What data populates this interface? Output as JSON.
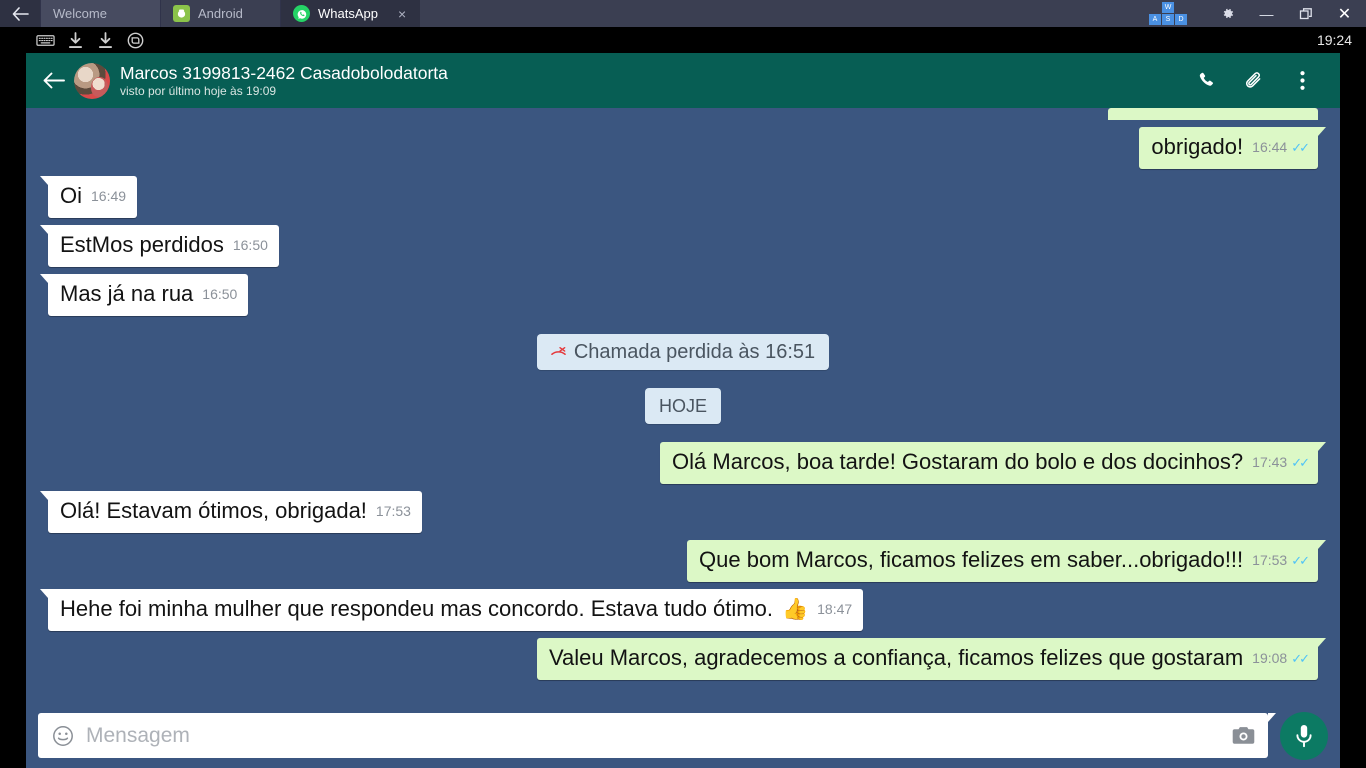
{
  "emulator": {
    "back_icon": "back-arrow-icon",
    "tabs": [
      {
        "label": "Welcome",
        "icon": "none",
        "active": false,
        "closable": false
      },
      {
        "label": "Android",
        "icon": "android-icon",
        "active": false,
        "closable": false
      },
      {
        "label": "WhatsApp",
        "icon": "whatsapp-icon",
        "active": true,
        "closable": true
      }
    ],
    "close_label": "×",
    "keymap_keys": [
      "W",
      "A",
      "S",
      "D"
    ],
    "window_controls": {
      "settings": "gear-icon",
      "minimize": "—",
      "maximize": "maximize-icon",
      "close": "✕"
    },
    "toolbar_icons": [
      "keyboard-icon",
      "download-icon",
      "download-icon",
      "screenshot-icon"
    ],
    "clock": "19:24"
  },
  "whatsapp": {
    "header": {
      "back": "←",
      "contact_name": "Marcos 3199813-2462 Casadobolodatorta",
      "last_seen": "visto por último hoje às 19:09",
      "actions": [
        "call-icon",
        "attach-icon",
        "overflow-menu-icon"
      ]
    },
    "messages": [
      {
        "kind": "partial",
        "side": "out"
      },
      {
        "kind": "text",
        "side": "out",
        "text": "obrigado!",
        "time": "16:44",
        "ticks": "✓✓"
      },
      {
        "kind": "text",
        "side": "in",
        "text": "Oi",
        "time": "16:49"
      },
      {
        "kind": "text",
        "side": "in",
        "text": "EstMos perdidos",
        "time": "16:50"
      },
      {
        "kind": "text",
        "side": "in",
        "text": "Mas já na rua",
        "time": "16:50"
      },
      {
        "kind": "system",
        "text": "Chamada perdida às 16:51",
        "icon": "missed-call-icon"
      },
      {
        "kind": "day",
        "text": "HOJE"
      },
      {
        "kind": "text",
        "side": "out",
        "text": "Olá Marcos, boa tarde! Gostaram do bolo e dos docinhos?",
        "time": "17:43",
        "ticks": "✓✓"
      },
      {
        "kind": "text",
        "side": "in",
        "text": "Olá! Estavam ótimos, obrigada!",
        "time": "17:53"
      },
      {
        "kind": "text",
        "side": "out",
        "text": "Que bom Marcos, ficamos felizes em saber...obrigado!!!",
        "time": "17:53",
        "ticks": "✓✓"
      },
      {
        "kind": "text",
        "side": "in",
        "text": "Hehe foi minha mulher que respondeu mas concordo. Estava tudo ótimo.",
        "emoji": "👍",
        "time": "18:47"
      },
      {
        "kind": "text",
        "side": "out",
        "text": "Valeu Marcos, agradecemos a confiança, ficamos felizes que gostaram",
        "time": "19:08",
        "ticks": "✓✓"
      }
    ],
    "input": {
      "emoji_icon": "smiley-icon",
      "placeholder": "Mensagem",
      "value": "",
      "camera_icon": "camera-icon",
      "mic_icon": "microphone-icon"
    }
  },
  "colors": {
    "titlebar": "#3b3f52",
    "wa_header": "#075e54",
    "chat_bg": "#3b5680",
    "outgoing_bubble": "#dcf8c6",
    "incoming_bubble": "#ffffff",
    "system_bubble": "#dbe9f4",
    "tick_blue": "#4fc3f7",
    "mic_green": "#0c7a63",
    "android_green": "#8bc34a"
  }
}
